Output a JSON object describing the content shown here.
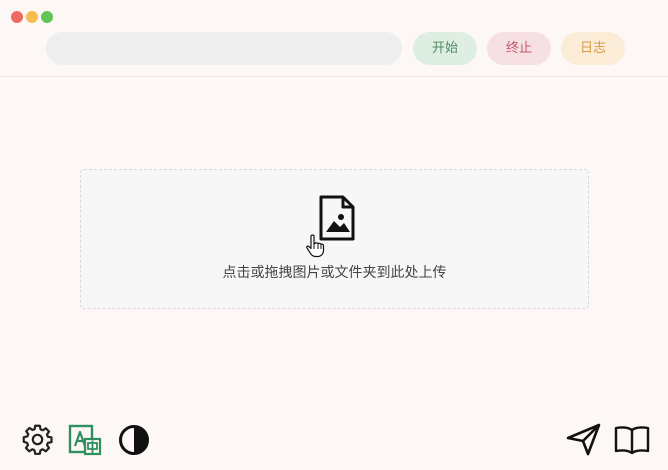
{
  "window": {
    "controls": [
      "close",
      "minimize",
      "maximize"
    ]
  },
  "toolbar": {
    "url_placeholder": "",
    "start_label": "开始",
    "stop_label": "终止",
    "log_label": "日志"
  },
  "dropzone": {
    "icon": "image-file-icon",
    "hint": "点击或拖拽图片或文件夹到此处上传"
  },
  "footer": {
    "left_icons": [
      "gear-icon",
      "translate-icon",
      "contrast-icon"
    ],
    "right_icons": [
      "send-icon",
      "book-icon"
    ]
  },
  "colors": {
    "start_bg": "#dfeee3",
    "start_text": "#4f8a61",
    "stop_bg": "#f6e0e3",
    "stop_text": "#c45a6b",
    "log_bg": "#fbecd8",
    "log_text": "#d49a48",
    "translate_green": "#2f8f5f"
  }
}
